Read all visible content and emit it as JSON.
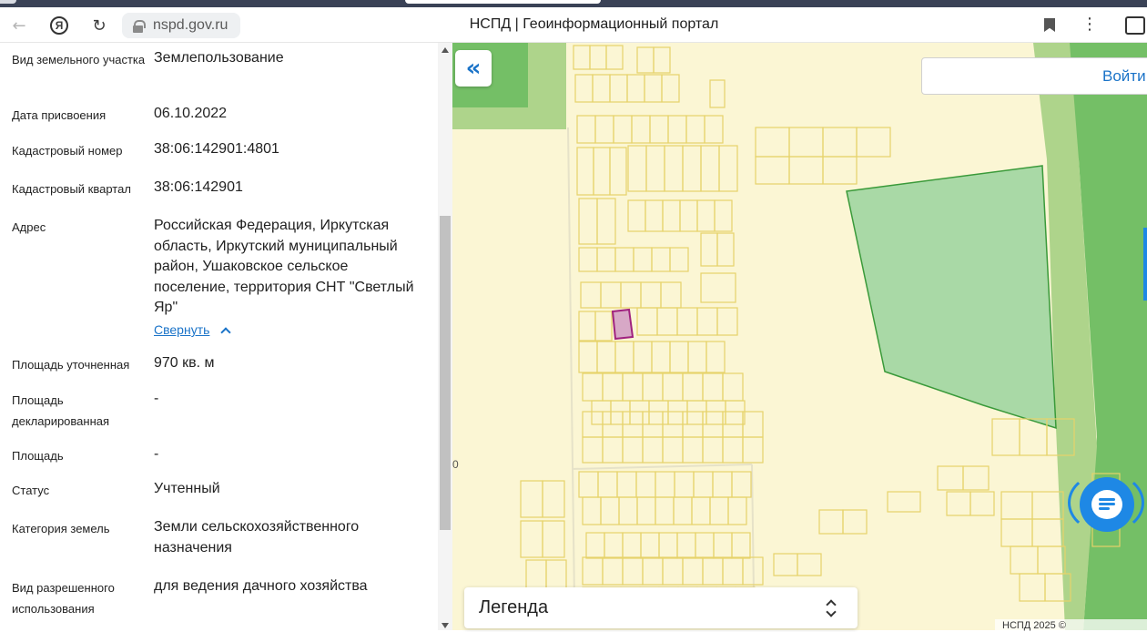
{
  "browser": {
    "url": "nspd.gov.ru",
    "title": "НСПД | Геоинформационный портал"
  },
  "panel": {
    "fields": [
      {
        "label": "Вид земельного участка",
        "value": "Землепользование"
      },
      {
        "label": "Дата присвоения",
        "value": "06.10.2022"
      },
      {
        "label": "Кадастровый номер",
        "value": "38:06:142901:4801"
      },
      {
        "label": "Кадастровый квартал",
        "value": "38:06:142901"
      },
      {
        "label": "Адрес",
        "value": "Российская Федерация, Иркутская область, Иркутский муниципальный район, Ушаковское сельское поселение, территория СНТ \"Светлый Яр\""
      },
      {
        "label": "Площадь уточненная",
        "value": "970 кв. м"
      },
      {
        "label": "Площадь декларированная",
        "value": "-"
      },
      {
        "label": "Площадь",
        "value": "-"
      },
      {
        "label": "Статус",
        "value": "Учтенный"
      },
      {
        "label": "Категория земель",
        "value": "Земли сельскохозяйственного назначения"
      },
      {
        "label": "Вид разрешенного использования",
        "value": "для ведения дачного хозяйства"
      }
    ],
    "collapse_label": "Свернуть"
  },
  "map": {
    "login_label": "Войти",
    "legend_label": "Легенда",
    "copyright": "НСПД 2025 ©",
    "edge_label": "0",
    "colors": {
      "background": "#fbf6d4",
      "forest": "#74bf66",
      "meadow": "#aed48b",
      "parcel_line": "#e7d36a",
      "selected_fill": "#d7a8c6",
      "selected_stroke": "#a0227f",
      "green_zone": "#a9d9a6"
    }
  }
}
